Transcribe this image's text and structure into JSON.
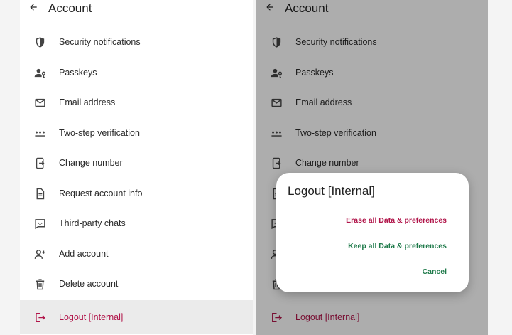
{
  "header": {
    "title": "Account"
  },
  "menu": {
    "items": [
      {
        "label": "Security notifications",
        "icon": "shield-icon"
      },
      {
        "label": "Passkeys",
        "icon": "person-key-icon"
      },
      {
        "label": "Email address",
        "icon": "envelope-icon"
      },
      {
        "label": "Two-step verification",
        "icon": "dots-icon"
      },
      {
        "label": "Change number",
        "icon": "phone-change-icon"
      },
      {
        "label": "Request account info",
        "icon": "document-icon"
      },
      {
        "label": "Third-party chats",
        "icon": "chat-icon"
      },
      {
        "label": "Add account",
        "icon": "add-person-icon"
      },
      {
        "label": "Delete account",
        "icon": "trash-icon"
      }
    ],
    "logout": {
      "label": "Logout [Internal]",
      "icon": "logout-icon"
    }
  },
  "dialog": {
    "title": "Logout [Internal]",
    "erase_label": "Erase all Data & preferences",
    "keep_label": "Keep all Data & preferences",
    "cancel_label": "Cancel"
  },
  "colors": {
    "logout_accent": "#b1154a",
    "action_green": "#1e7a4a",
    "scrim": "rgba(0,0,0,0.32)"
  }
}
